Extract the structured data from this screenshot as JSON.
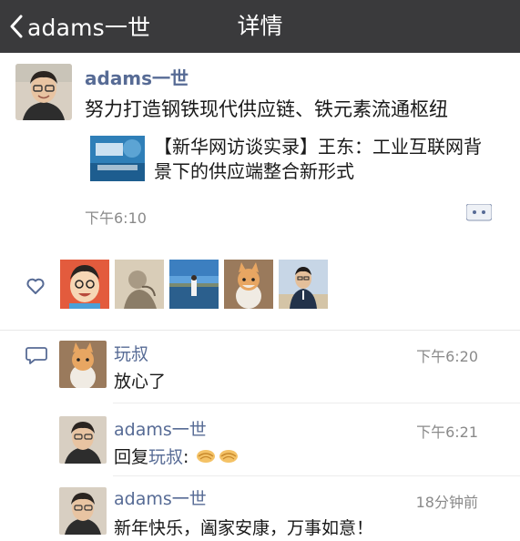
{
  "nav": {
    "back_label": "adams一世",
    "title": "详情"
  },
  "post": {
    "author": "adams一世",
    "text": "努力打造钢铁现代供应链、铁元素流通枢纽",
    "link": {
      "title": "【新华网访谈实录】王东：工业互联网背景下的供应端整合新形式"
    },
    "time": "下午6:10"
  },
  "comments": [
    {
      "author": "玩叔",
      "time": "下午6:20",
      "text": "放心了"
    },
    {
      "author": "adams一世",
      "time": "下午6:21",
      "reply_prefix": "回复",
      "reply_to": "玩叔",
      "reply_suffix": ":",
      "emoji": "handshake handshake"
    },
    {
      "author": "adams一世",
      "time": "18分钟前",
      "text": "新年快乐，阖家安康，万事如意！"
    }
  ],
  "colors": {
    "nav_bg": "#3a3a3c",
    "name_link": "#576b95",
    "timestamp": "#8a8a8a"
  }
}
